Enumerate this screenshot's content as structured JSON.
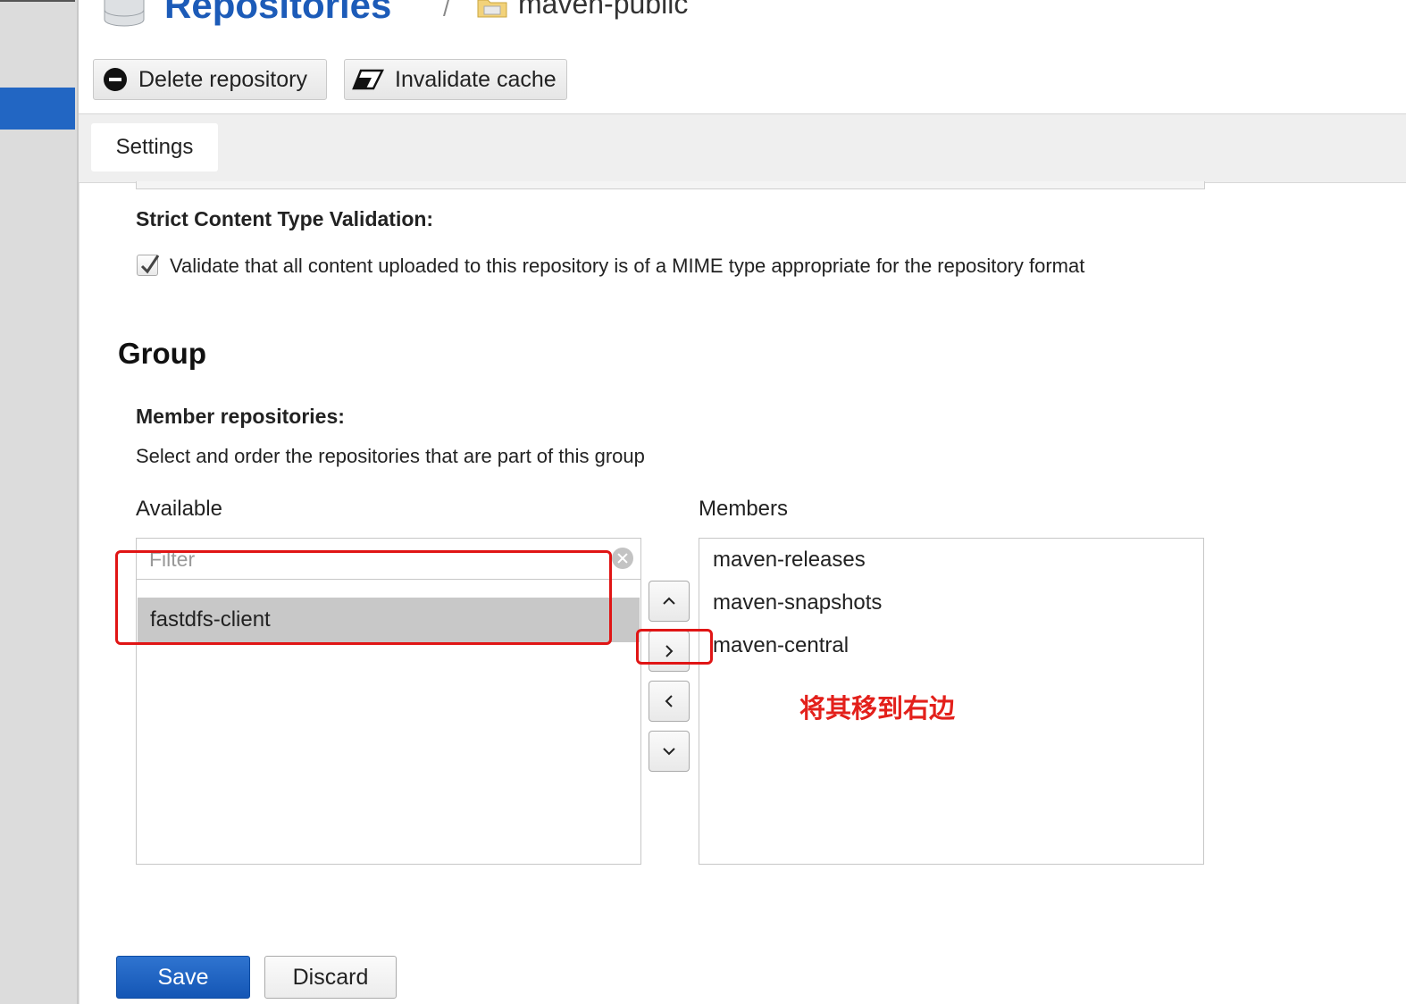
{
  "header": {
    "title": "Repositories",
    "separator": "/",
    "crumb": "maven-public",
    "toolbar": {
      "delete_label": "Delete repository",
      "invalidate_label": "Invalidate cache"
    }
  },
  "tabs": [
    {
      "label": "Settings"
    }
  ],
  "strict_validation": {
    "label": "Strict Content Type Validation:",
    "checkbox_text": "Validate that all content uploaded to this repository is of a MIME type appropriate for the repository format",
    "checked": true
  },
  "group": {
    "title": "Group",
    "members_label": "Member repositories:",
    "help": "Select and order the repositories that are part of this group",
    "available_label": "Available",
    "members_heading": "Members",
    "filter_placeholder": "Filter",
    "available": [
      "fastdfs-client"
    ],
    "members": [
      "maven-releases",
      "maven-snapshots",
      "maven-central"
    ]
  },
  "annotation": "将其移到右边",
  "footer": {
    "save_label": "Save",
    "discard_label": "Discard"
  },
  "colors": {
    "accent": "#1c5bb8",
    "primary_button": "#1456b5",
    "annotation_red": "#e3201b"
  },
  "icons": [
    "database-icon",
    "folder-icon",
    "minus-circle-icon",
    "eraser-icon",
    "check-icon",
    "clear-icon",
    "chevron-up-icon",
    "chevron-right-icon",
    "chevron-left-icon",
    "chevron-down-icon"
  ]
}
